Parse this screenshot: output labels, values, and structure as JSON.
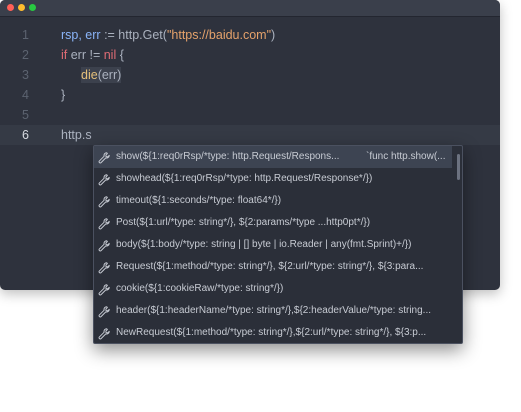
{
  "editor": {
    "line_numbers": [
      "1",
      "2",
      "3",
      "4",
      "5",
      "6"
    ],
    "lines": {
      "l1": {
        "a": "rsp, err",
        "b": " := http.Get(",
        "c": "\"https://baidu.com\"",
        "d": ")"
      },
      "l2": {
        "a": "if",
        "b": " err != ",
        "c": "nil",
        "d": " {"
      },
      "l3": {
        "a": "die",
        "b": "(err)"
      },
      "l4": {
        "a": "}"
      },
      "l6": {
        "a": "http.s"
      }
    }
  },
  "autocomplete": {
    "items": [
      {
        "text": "show(${1:req0rRsp/*type: http.Request/Respons...",
        "hint": "`func http.show(..."
      },
      {
        "text": "showhead(${1:req0rRsp/*type: http.Request/Response*/})"
      },
      {
        "text": "timeout(${1:seconds/*type: float64*/})"
      },
      {
        "text": "Post(${1:url/*type: string*/}, ${2:params/*type ...http0pt*/})"
      },
      {
        "text": "body(${1:body/*type: string | [] byte | io.Reader | any(fmt.Sprint)+/})"
      },
      {
        "text": "Request(${1:method/*type: string*/}, ${2:url/*type: string*/}, ${3:para..."
      },
      {
        "text": "cookie(${1:cookieRaw/*type: string*/})"
      },
      {
        "text": "header(${1:headerName/*type: string*/},${2:headerValue/*type: string..."
      },
      {
        "text": "NewRequest(${1:method/*type: string*/},${2:url/*type: string*/}, ${3:p..."
      }
    ],
    "icon": "wrench-icon",
    "selected_index": 0
  },
  "colors": {
    "keyword": "#e06c75",
    "string": "#e5a26b",
    "function": "#e5c07b",
    "variable": "#8ab4f8"
  }
}
